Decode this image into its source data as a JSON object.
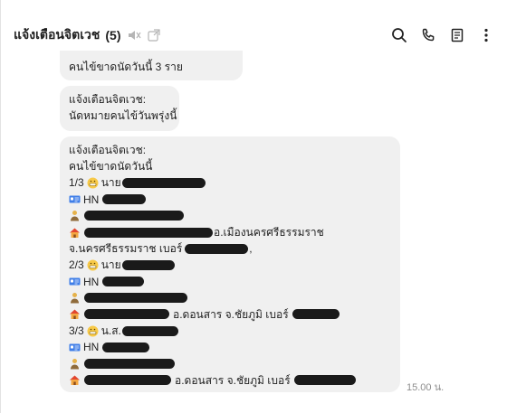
{
  "header": {
    "title": "แจ้งเตือนจิตเวช",
    "member_count": "(5)",
    "icons": [
      "search-icon",
      "phone-icon",
      "notes-icon",
      "more-icon"
    ]
  },
  "messages": [
    {
      "lines": [
        "คนไข้ขาดนัดวันนี้ 3 ราย"
      ]
    },
    {
      "lines": [
        "แจ้งเตือนจิตเวช:",
        "นัดหมายคนไข้วันพรุ่งนี้"
      ]
    },
    {
      "header_lines": [
        "แจ้งเตือนจิตเวช:",
        "คนไข้ขาดนัดวันนี้"
      ],
      "patients": [
        {
          "index": "1/3",
          "title": "นาย",
          "hn_label": "HN",
          "district": "อ.เมืองนครศรีธรรมราช",
          "province_phone": "จ.นครศรีธรรมราช เบอร์",
          "tail": ","
        },
        {
          "index": "2/3",
          "title": "นาย",
          "hn_label": "HN",
          "address": "อ.ดอนสาร  จ.ชัยภูมิ เบอร์"
        },
        {
          "index": "3/3",
          "title": "น.ส.",
          "hn_label": "HN",
          "address": "อ.ดอนสาร จ.ชัยภูมิ เบอร์"
        }
      ]
    }
  ],
  "timestamp": "15.00 น."
}
